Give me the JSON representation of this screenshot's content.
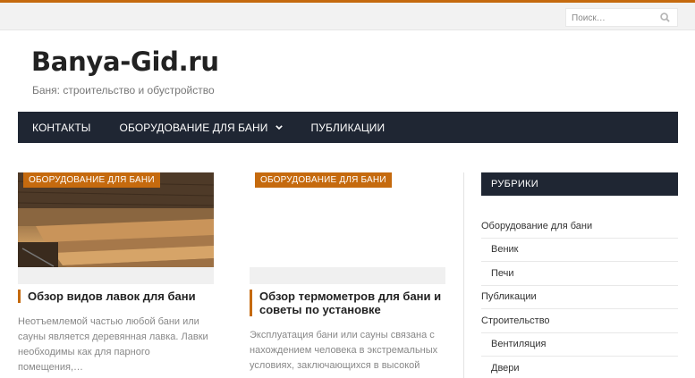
{
  "search": {
    "placeholder": "Поиск…"
  },
  "site": {
    "title": "Banya-Gid.ru",
    "description": "Баня: строительство и обустройство"
  },
  "nav": {
    "items": [
      {
        "label": "КОНТАКТЫ"
      },
      {
        "label": "ОБОРУДОВАНИЕ ДЛЯ БАНИ",
        "has_dropdown": true
      },
      {
        "label": "ПУБЛИКАЦИИ"
      }
    ]
  },
  "posts": [
    {
      "category": "ОБОРУДОВАНИЕ ДЛЯ БАНИ",
      "title": "Обзор видов лавок для бани",
      "excerpt": "Неотъемлемой частью любой бани или сауны является деревянная лавка. Лавки необходимы как для парного помещения,…"
    },
    {
      "category": "ОБОРУДОВАНИЕ ДЛЯ БАНИ",
      "title": "Обзор термометров для бани и советы по установке",
      "excerpt": "Эксплуатация бани или сауны связана с нахождением человека в экстремальных условиях, заключающихся в высокой температуре,…"
    }
  ],
  "sidebar": {
    "widget_title": "РУБРИКИ",
    "categories": [
      {
        "label": "Оборудование для бани",
        "level": 0
      },
      {
        "label": "Веник",
        "level": 1
      },
      {
        "label": "Печи",
        "level": 1
      },
      {
        "label": "Публикации",
        "level": 0
      },
      {
        "label": "Строительство",
        "level": 0
      },
      {
        "label": "Вентиляция",
        "level": 1
      },
      {
        "label": "Двери",
        "level": 1
      }
    ]
  },
  "colors": {
    "accent": "#c56a0e",
    "nav_bg": "#1f2633"
  },
  "icons": {
    "search": "search-icon",
    "dropdown": "chevron-down-icon"
  }
}
